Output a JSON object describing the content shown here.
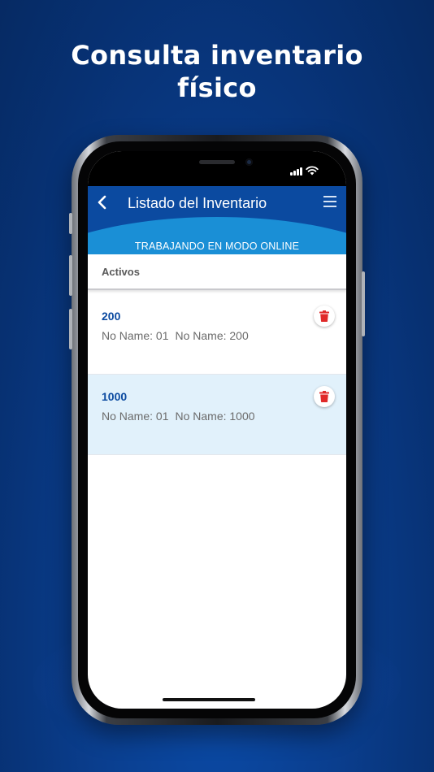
{
  "headline": {
    "line1": "Consulta inventario",
    "line2": "físico"
  },
  "app": {
    "title": "Listado del Inventario",
    "mode_banner": "TRABAJANDO EN MODO ONLINE",
    "back_icon": "chevron-left-icon",
    "menu_icon": "menu-icon"
  },
  "section": {
    "title": "Activos"
  },
  "items": [
    {
      "id": "200",
      "field1": "No Name: 01",
      "field2": "No Name: 200",
      "selected": false,
      "delete_icon": "trash-icon"
    },
    {
      "id": "1000",
      "field1": "No Name: 01",
      "field2": "No Name: 1000",
      "selected": true,
      "delete_icon": "trash-icon"
    }
  ],
  "colors": {
    "background": "#0a3e8e",
    "appbar": "#0b4aa0",
    "appbar_arc": "#1a8fd6",
    "accent_text": "#0b4aa0",
    "delete": "#e02a2a",
    "selected_row": "#e1f1fb"
  }
}
